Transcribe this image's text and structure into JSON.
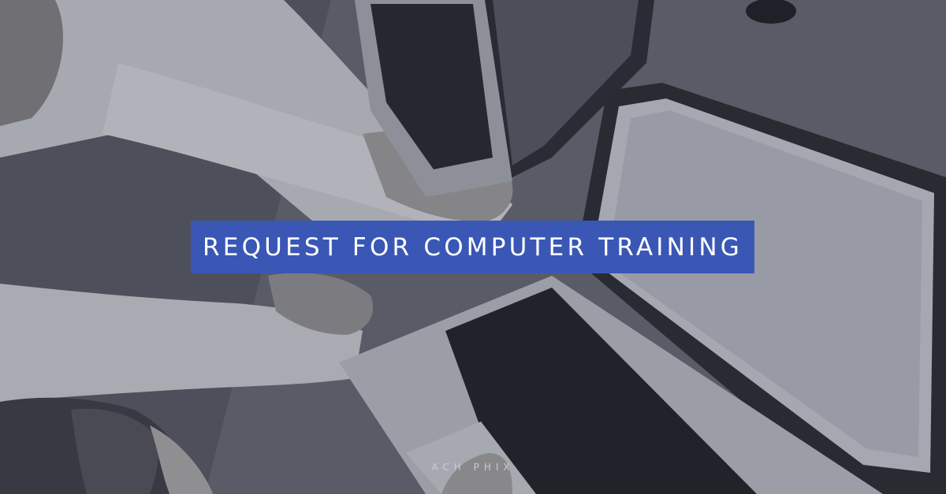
{
  "banner": {
    "title": "REQUEST FOR COMPUTER TRAINING",
    "brand": "ACH PHIX"
  },
  "colors": {
    "title_background": "#3a57b5",
    "title_text": "#ffffff",
    "brand_text": "#c9cbd2",
    "photo_tint": "#4a4d55"
  },
  "image": {
    "subject": "overhead photo of people working on laptops"
  }
}
